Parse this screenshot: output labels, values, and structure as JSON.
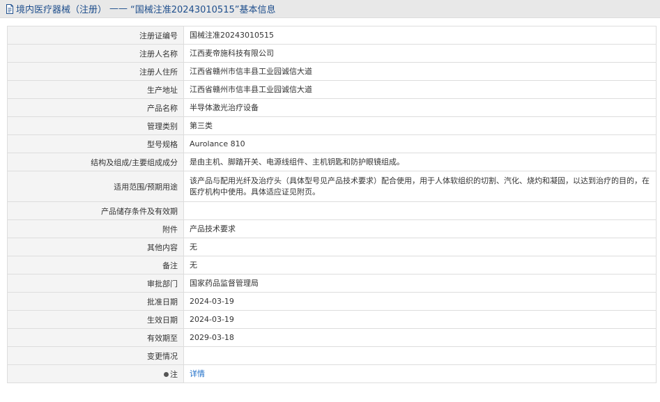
{
  "header": {
    "icon": "document-icon",
    "prefix": "境内医疗器械（注册）",
    "separator": "——",
    "title": "“国械注准20243010515”基本信息"
  },
  "table": {
    "rows": [
      {
        "label": "注册证编号",
        "value": "国械注准20243010515"
      },
      {
        "label": "注册人名称",
        "value": "江西麦帝施科技有限公司"
      },
      {
        "label": "注册人住所",
        "value": "江西省赣州市信丰县工业园诚信大道"
      },
      {
        "label": "生产地址",
        "value": "江西省赣州市信丰县工业园诚信大道"
      },
      {
        "label": "产品名称",
        "value": "半导体激光治疗设备"
      },
      {
        "label": "管理类别",
        "value": "第三类"
      },
      {
        "label": "型号规格",
        "value": "Aurolance 810"
      },
      {
        "label": "结构及组成/主要组成成分",
        "value": "是由主机、脚踏开关、电源线组件、主机钥匙和防护眼镜组成。"
      },
      {
        "label": "适用范围/预期用途",
        "value": "该产品与配用光纤及治疗头（具体型号见产品技术要求）配合使用，用于人体软组织的切割、汽化、烧灼和凝固，以达到治疗的目的，在医疗机构中使用。具体适应证见附页。"
      },
      {
        "label": "产品储存条件及有效期",
        "value": ""
      },
      {
        "label": "附件",
        "value": "产品技术要求"
      },
      {
        "label": "其他内容",
        "value": "无"
      },
      {
        "label": "备注",
        "value": "无"
      },
      {
        "label": "审批部门",
        "value": "国家药品监督管理局"
      },
      {
        "label": "批准日期",
        "value": "2024-03-19"
      },
      {
        "label": "生效日期",
        "value": "2024-03-19"
      },
      {
        "label": "有效期至",
        "value": "2029-03-18"
      },
      {
        "label": "变更情况",
        "value": ""
      }
    ],
    "note_row": {
      "label": "注",
      "link": "详情"
    }
  }
}
